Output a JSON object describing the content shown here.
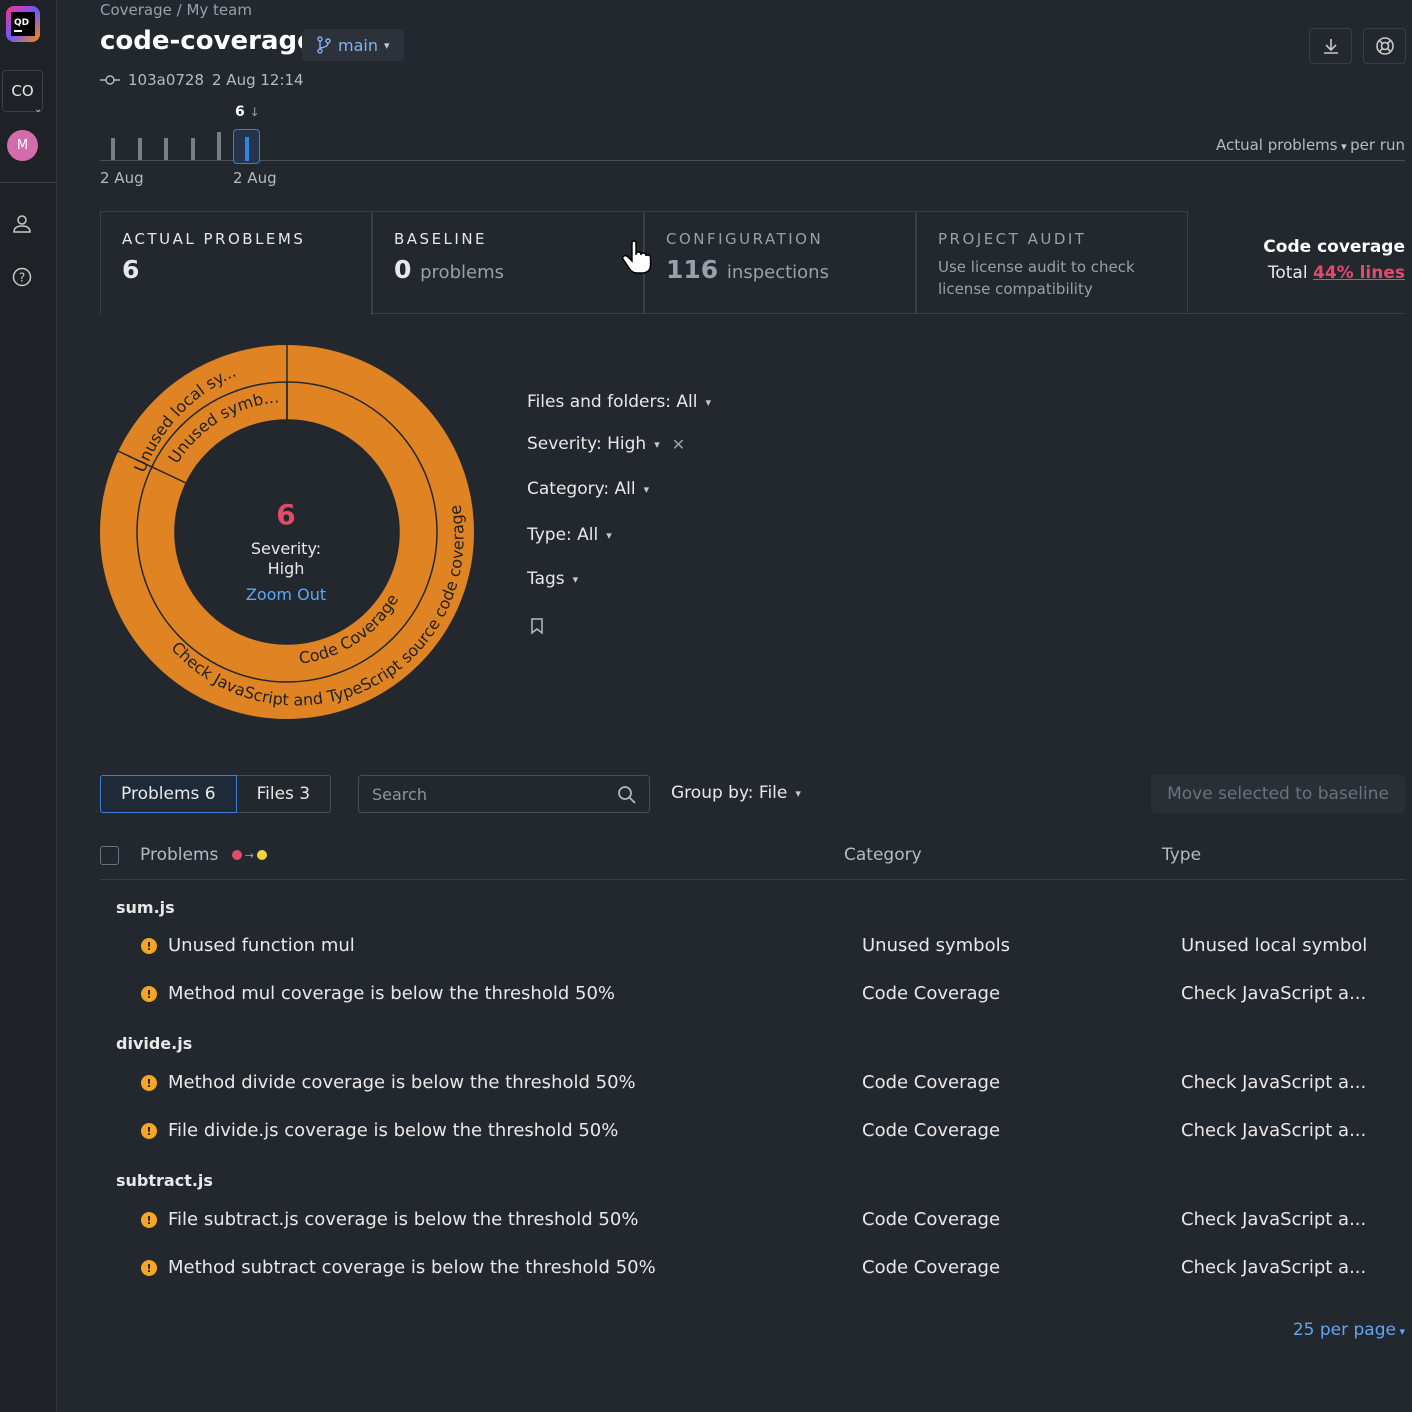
{
  "sidebar": {
    "project_initials": "CO",
    "avatar_initial": "M"
  },
  "header": {
    "breadcrumb": "Coverage / My team",
    "title": "code-coverage",
    "branch": "main",
    "commit_hash": "103a0728",
    "commit_time": "2 Aug 12:14"
  },
  "timeline": {
    "selected_count": "6",
    "selected_arrow": "↓",
    "date_left": "2 Aug",
    "date_right": "2 Aug",
    "metric": "Actual problems",
    "per": "per run"
  },
  "cards": {
    "actual": {
      "label": "ACTUAL PROBLEMS",
      "value": "6"
    },
    "baseline": {
      "label": "BASELINE",
      "value": "0",
      "unit": "problems"
    },
    "configuration": {
      "label": "CONFIGURATION",
      "value": "116",
      "unit": "inspections"
    },
    "audit": {
      "label": "PROJECT AUDIT",
      "desc": "Use license audit to check license compatibility"
    }
  },
  "coverage": {
    "title": "Code coverage",
    "total_prefix": "Total",
    "total_value": "44% lines"
  },
  "donut": {
    "count": "6",
    "label_line1": "Severity:",
    "label_line2": "High",
    "zoom": "Zoom Out",
    "inner_labels": [
      "Unused symb...",
      "Code Coverage"
    ],
    "outer_labels": [
      "Unused local sy...",
      "Check JavaScript and TypeScript source code coverage"
    ],
    "color": "#e08423"
  },
  "filters": {
    "files": "Files and folders: All",
    "severity": "Severity: High",
    "category": "Category: All",
    "type": "Type: All",
    "tags": "Tags"
  },
  "toolbar": {
    "tab_problems": "Problems 6",
    "tab_files": "Files 3",
    "search_placeholder": "Search",
    "groupby": "Group by: File",
    "move": "Move selected to baseline"
  },
  "table": {
    "col_problems": "Problems",
    "col_category": "Category",
    "col_type": "Type",
    "groups": [
      {
        "file": "sum.js",
        "rows": [
          {
            "name": "Unused function mul",
            "category": "Unused symbols",
            "type": "Unused local symbol"
          },
          {
            "name": "Method mul coverage is below the threshold 50%",
            "category": "Code Coverage",
            "type": "Check JavaScript a..."
          }
        ]
      },
      {
        "file": "divide.js",
        "rows": [
          {
            "name": "Method divide coverage is below the threshold 50%",
            "category": "Code Coverage",
            "type": "Check JavaScript a..."
          },
          {
            "name": "File divide.js coverage is below the threshold 50%",
            "category": "Code Coverage",
            "type": "Check JavaScript a..."
          }
        ]
      },
      {
        "file": "subtract.js",
        "rows": [
          {
            "name": "File subtract.js coverage is below the threshold 50%",
            "category": "Code Coverage",
            "type": "Check JavaScript a..."
          },
          {
            "name": "Method subtract coverage is below the threshold 50%",
            "category": "Code Coverage",
            "type": "Check JavaScript a..."
          }
        ]
      }
    ]
  },
  "pagination": {
    "per_page": "25 per page"
  }
}
